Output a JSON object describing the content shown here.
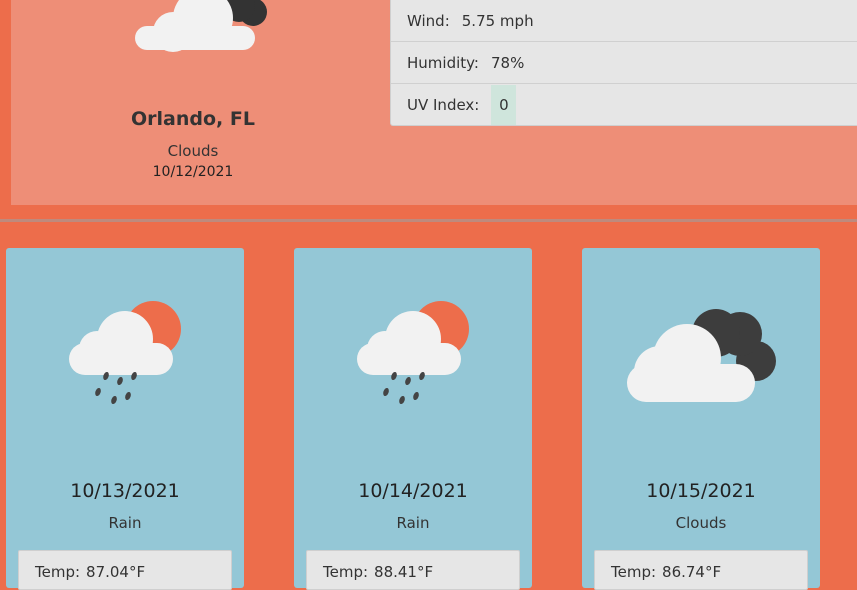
{
  "current": {
    "city": "Orlando, FL",
    "condition": "Clouds",
    "date": "10/12/2021",
    "icon": "cloudy-icon",
    "stats": {
      "wind_label": "Wind:",
      "wind_value": "5.75 mph",
      "humidity_label": "Humidity:",
      "humidity_value": "78%",
      "uv_label": "UV Index:",
      "uv_value": "0"
    }
  },
  "forecast": [
    {
      "date": "10/13/2021",
      "condition": "Rain",
      "icon": "rain-sun-icon",
      "temp_label": "Temp:",
      "temp_value": "87.04°F"
    },
    {
      "date": "10/14/2021",
      "condition": "Rain",
      "icon": "rain-sun-icon",
      "temp_label": "Temp:",
      "temp_value": "88.41°F"
    },
    {
      "date": "10/15/2021",
      "condition": "Clouds",
      "icon": "cloudy-icon",
      "temp_label": "Temp:",
      "temp_value": "86.74°F"
    }
  ],
  "colors": {
    "background": "#ed6d4b",
    "current_panel": "#ee8e77",
    "card": "#94c7d6",
    "stat_panel": "#e6e6e6",
    "uv_badge": "#cfe5dc"
  }
}
